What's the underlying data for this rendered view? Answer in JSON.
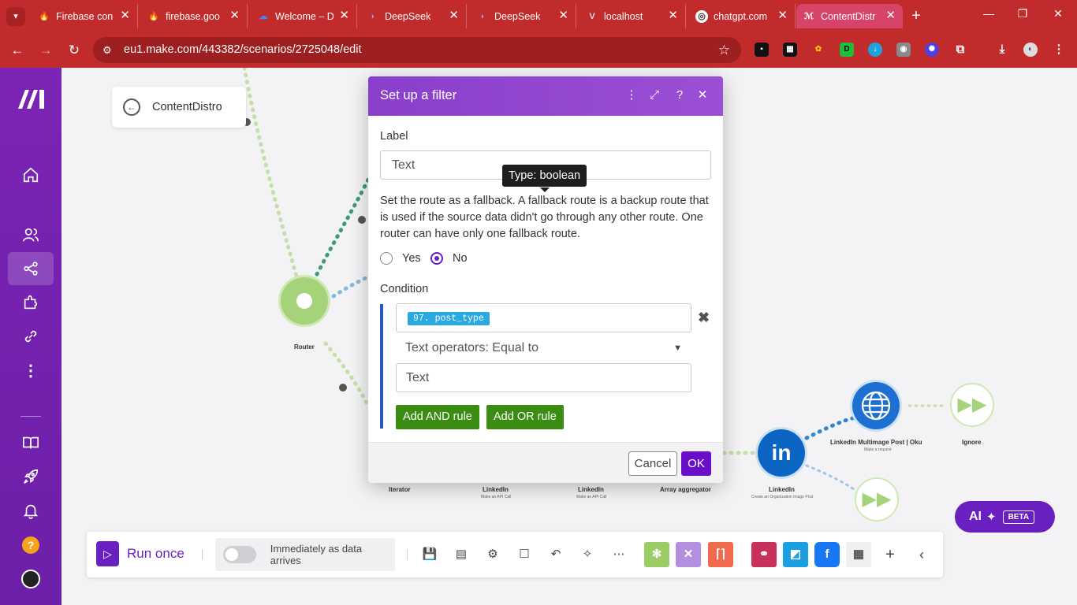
{
  "browser": {
    "tabs": [
      {
        "title": "Firebase con",
        "icon": "firebase-icon",
        "color": "#ffa000"
      },
      {
        "title": "firebase.goo",
        "icon": "firebase-icon",
        "color": "#ffa000"
      },
      {
        "title": "Welcome – D",
        "icon": "google-cloud-icon",
        "color": "#4285f4"
      },
      {
        "title": "DeepSeek",
        "icon": "deepseek-icon",
        "color": "#4d6bfe"
      },
      {
        "title": "DeepSeek",
        "icon": "deepseek-icon",
        "color": "#4d6bfe"
      },
      {
        "title": "localhost",
        "icon": "vue-icon",
        "color": "#bbbbbb"
      },
      {
        "title": "chatgpt.com",
        "icon": "chatgpt-icon",
        "color": "#ffffff"
      },
      {
        "title": "ContentDistr",
        "icon": "make-icon",
        "color": "#7b24b5",
        "active": true
      }
    ],
    "url": "eu1.make.com/443382/scenarios/2725048/edit",
    "chrome_color": "#c22b2b"
  },
  "sidebar": {
    "accent": "#7b24b5",
    "items": [
      "home-icon",
      "team-icon",
      "scenarios-icon",
      "apps-icon",
      "connections-icon",
      "more-icon",
      "docs-icon",
      "launch-icon",
      "notifications-icon",
      "help-icon",
      "avatar"
    ],
    "help_label": "?"
  },
  "canvas": {
    "scenario_name": "ContentDistro",
    "modules": {
      "router": "Router",
      "iterator": "Iterator",
      "linkedin_1": "LinkedIn",
      "linkedin_1_sub": "Make an API Call",
      "linkedin_2": "LinkedIn",
      "linkedin_2_sub": "Make an API Call",
      "array_aggregator": "Array aggregator",
      "linkedin_main": "LinkedIn",
      "linkedin_main_sub": "Create an Organization Image Post",
      "http": "LinkedIn Multimage Post | Oku",
      "http_sub": "Make a request",
      "ignore": "Ignore"
    }
  },
  "modal": {
    "title": "Set up a filter",
    "label_caption": "Label",
    "label_placeholder": "Text",
    "tooltip": "Type: boolean",
    "fallback_description": "Set the route as a fallback. A fallback route is a backup route that is used if the source data didn't go through any other route. One router can have only one fallback route.",
    "radio_yes": "Yes",
    "radio_no": "No",
    "selected": "No",
    "condition_caption": "Condition",
    "condition_field": "97. post_type",
    "operator": "Text operators: Equal to",
    "value_placeholder": "Text",
    "add_and": "Add AND rule",
    "add_or": "Add OR rule",
    "cancel": "Cancel",
    "ok": "OK",
    "header_color": "#8a3fcc"
  },
  "ai": {
    "label": "AI",
    "badge": "BETA"
  },
  "toolbar": {
    "run_once": "Run once",
    "schedule": "Immediately as data arrives"
  }
}
